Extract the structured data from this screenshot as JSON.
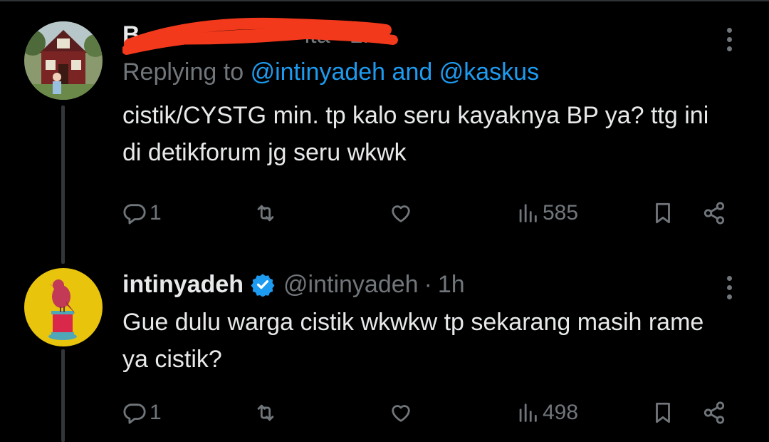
{
  "tweets": [
    {
      "name_visible": "B",
      "handle_visible": "ita",
      "time": "1h",
      "reply_prefix": "Replying to",
      "mention_1": "@intinyadeh",
      "reply_joiner": "and",
      "mention_2": "@kaskus",
      "text": "cistik/CYSTG min. tp kalo seru kayaknya BP ya? ttg ini di detikforum jg seru wkwk",
      "replies": "1",
      "views": "585",
      "name_redaction_color": "#f3391c"
    },
    {
      "display_name": "intinyadeh",
      "handle": "@intinyadeh",
      "time": "1h",
      "text": "Gue dulu warga cistik wkwkw tp sekarang masih rame ya cistik?",
      "replies": "1",
      "views": "498",
      "verified": true
    }
  ],
  "icons": {
    "reply": "speech-bubble-icon",
    "repost": "repost-arrows-icon",
    "like": "heart-icon",
    "views": "bar-chart-icon",
    "bookmark": "bookmark-icon",
    "share": "share-nodes-icon",
    "more": "vertical-ellipsis-icon",
    "verified": "verified-badge-icon"
  },
  "colors": {
    "background": "#000000",
    "text": "#e7e9ea",
    "muted": "#71767b",
    "accent": "#1d9bf0",
    "avatar_2_bg": "#e8c40c"
  }
}
